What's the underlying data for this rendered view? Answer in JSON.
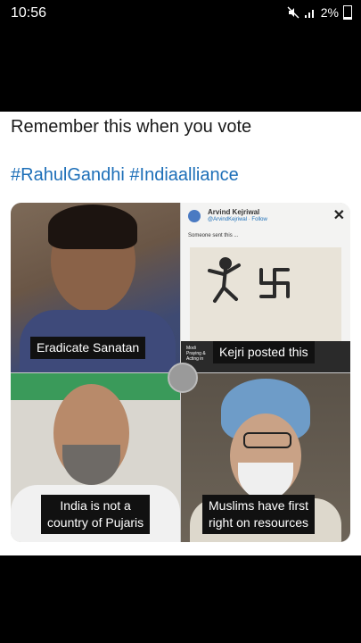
{
  "status_bar": {
    "time": "10:56",
    "battery": "2%",
    "mute_icon": "mute-icon",
    "signal_icon": "signal-icon"
  },
  "post": {
    "text_line1": "Remember this when you vote",
    "hashtags": "#RahulGandhi #Indiaalliance"
  },
  "collage": {
    "tile1_caption": "Eradicate Sanatan",
    "tile2": {
      "tweet_author": "Arvind Kejriwal",
      "tweet_handle": "@ArvindKejriwal · Follow",
      "tweet_text": "Someone sent this ...",
      "tiny_label": "Modi Praying & Acting in",
      "caption": "Kejri posted this"
    },
    "tile3_caption_line1": "India is not a",
    "tile3_caption_line2": "country of Pujaris",
    "tile4_caption_line1": "Muslims have first",
    "tile4_caption_line2": "right on resources"
  },
  "colors": {
    "hashtag": "#1d6fb8",
    "background": "#000000",
    "card": "#ffffff"
  }
}
